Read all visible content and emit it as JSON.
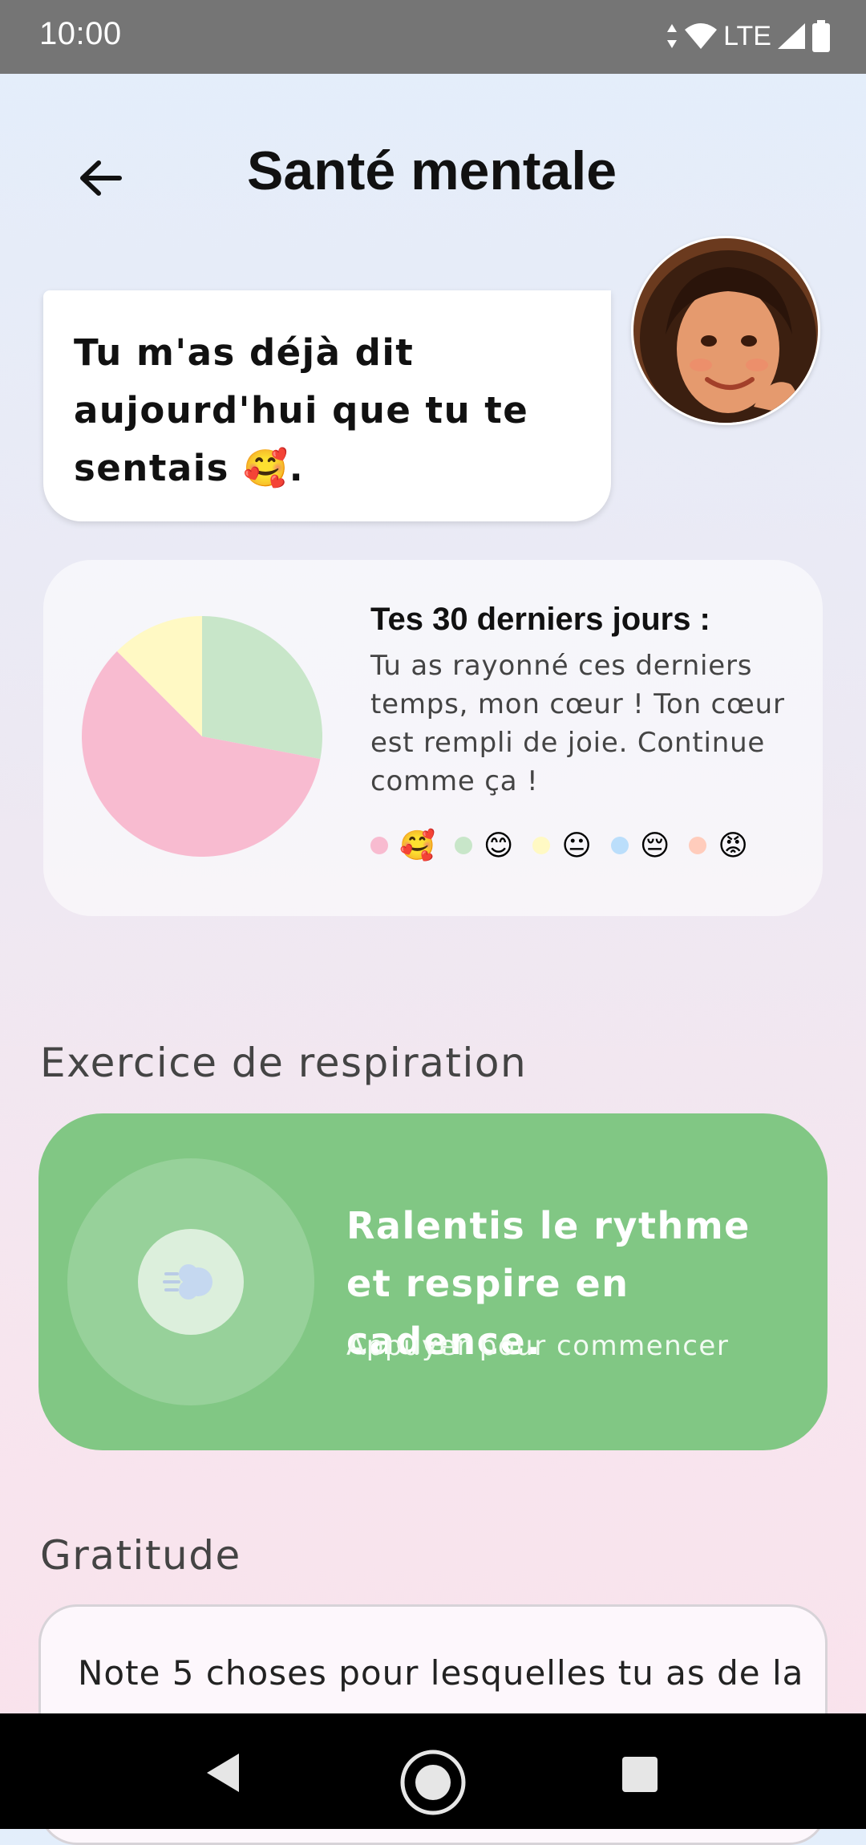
{
  "status_bar": {
    "time": "10:00",
    "network": "LTE"
  },
  "header": {
    "title": "Santé mentale"
  },
  "bubble": {
    "text": "Tu m'as déjà dit aujourd'hui que tu te sentais 🥰."
  },
  "mood_summary": {
    "title": "Tes 30 derniers jours :",
    "text": "Tu as rayonné ces derniers temps, mon cœur ! Ton cœur est rempli de joie. Continue comme ça !",
    "legend": [
      {
        "emoji": "🥰",
        "color": "#f8bbd0"
      },
      {
        "emoji": "😊",
        "color": "#c8e6c9"
      },
      {
        "emoji": "😐",
        "color": "#fff9c4"
      },
      {
        "emoji": "😔",
        "color": "#bbdefb"
      },
      {
        "emoji": "😡",
        "color": "#ffccbc"
      }
    ]
  },
  "chart_data": {
    "type": "pie",
    "slices": [
      {
        "emoji": "🥰",
        "value": 0.595,
        "color": "#f8bbd0"
      },
      {
        "emoji": "😊",
        "value": 0.28,
        "color": "#c8e6c9"
      },
      {
        "emoji": "😐",
        "value": 0.125,
        "color": "#fff9c4"
      }
    ]
  },
  "breathing": {
    "section_title": "Exercice de respiration",
    "title": "Ralentis le rythme et respire en cadence.",
    "subtitle": "Appuyer pour commencer",
    "icon": "wind-face-icon",
    "color": "#81c784"
  },
  "gratitude": {
    "section_title": "Gratitude",
    "text": "Note 5 choses pour lesquelles tu as de la"
  }
}
